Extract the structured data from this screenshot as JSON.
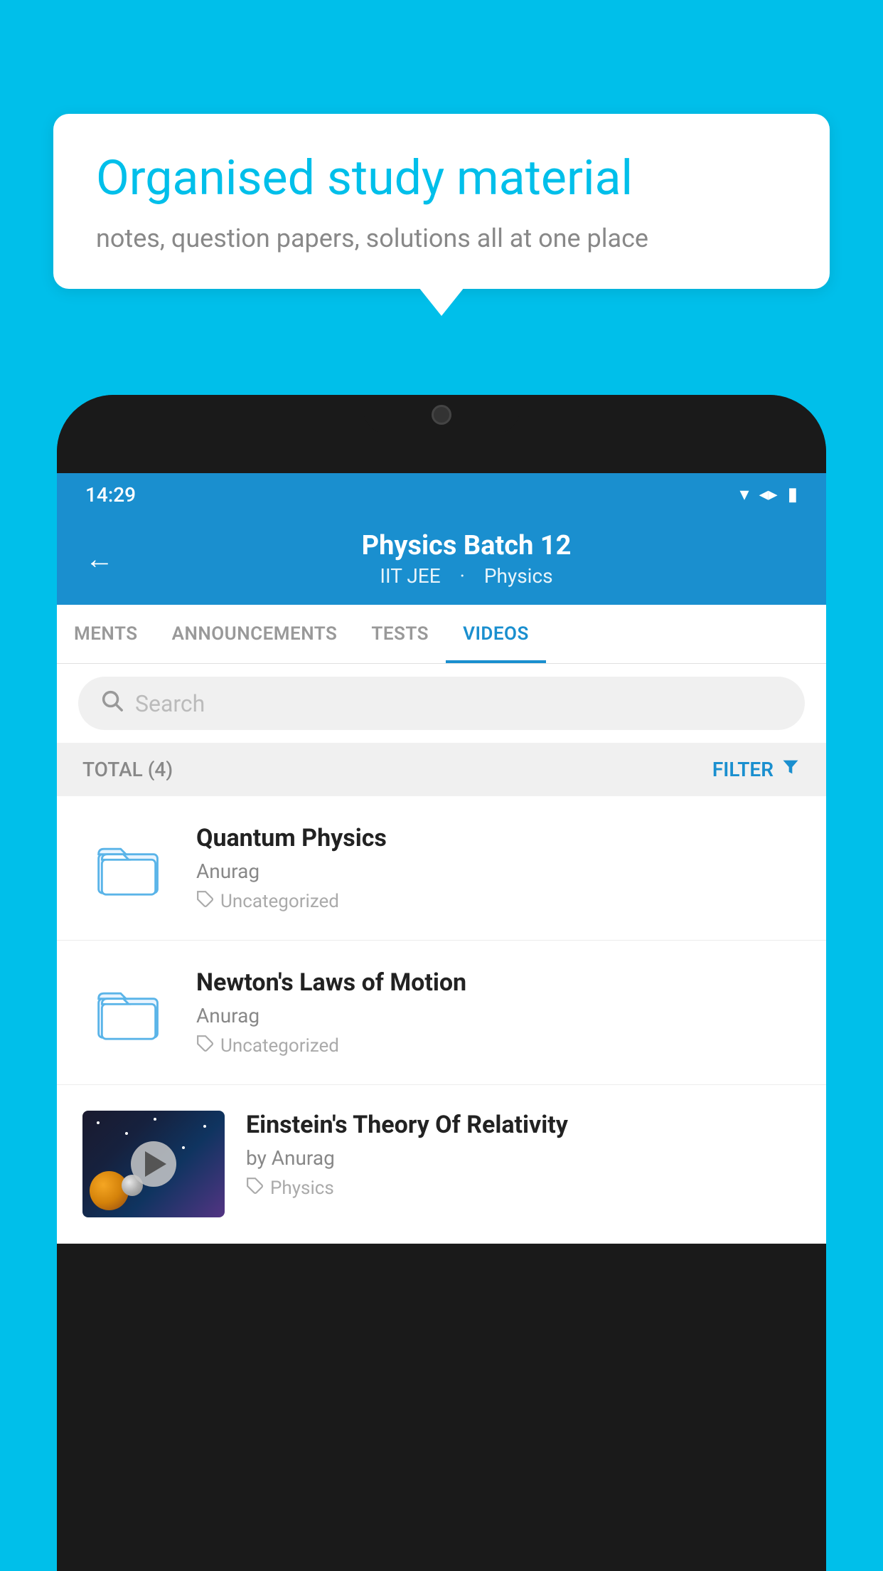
{
  "background_color": "#00BFEA",
  "speech_bubble": {
    "title": "Organised study material",
    "subtitle": "notes, question papers, solutions all at one place"
  },
  "status_bar": {
    "time": "14:29",
    "wifi": "▾",
    "signal": "▲",
    "battery": "▮"
  },
  "app_header": {
    "title": "Physics Batch 12",
    "subtitle_part1": "IIT JEE",
    "subtitle_part2": "Physics",
    "back_label": "←"
  },
  "tabs": [
    {
      "label": "MENTS",
      "active": false
    },
    {
      "label": "ANNOUNCEMENTS",
      "active": false
    },
    {
      "label": "TESTS",
      "active": false
    },
    {
      "label": "VIDEOS",
      "active": true
    }
  ],
  "search": {
    "placeholder": "Search"
  },
  "filter_bar": {
    "total_label": "TOTAL (4)",
    "filter_label": "FILTER"
  },
  "videos": [
    {
      "id": 1,
      "title": "Quantum Physics",
      "author": "Anurag",
      "tag": "Uncategorized",
      "type": "folder"
    },
    {
      "id": 2,
      "title": "Newton's Laws of Motion",
      "author": "Anurag",
      "tag": "Uncategorized",
      "type": "folder"
    },
    {
      "id": 3,
      "title": "Einstein's Theory Of Relativity",
      "author": "by Anurag",
      "tag": "Physics",
      "type": "thumbnail"
    }
  ]
}
